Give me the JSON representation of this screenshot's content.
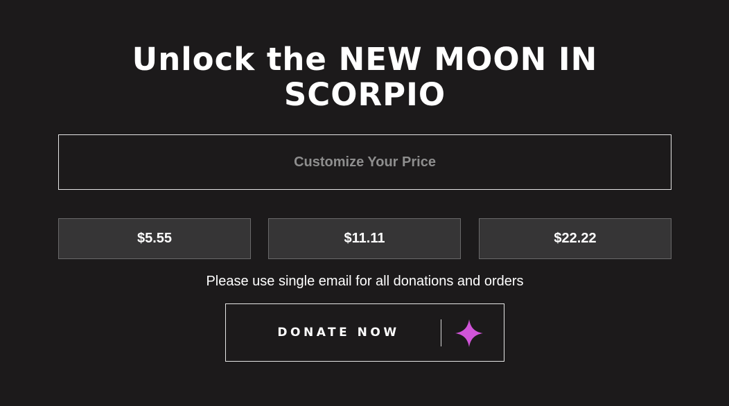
{
  "title": "Unlock the NEW MOON IN SCORPIO",
  "custom_price": {
    "placeholder": "Customize Your Price",
    "value": ""
  },
  "amounts": [
    {
      "label": "$5.55"
    },
    {
      "label": "$11.11"
    },
    {
      "label": "$22.22"
    }
  ],
  "notice": "Please use single email for all donations and orders",
  "donate": {
    "label": "DONATE NOW",
    "icon": "sparkle-icon"
  },
  "colors": {
    "background": "#1c1a1b",
    "button_fill": "#363536",
    "accent": "#d054d8",
    "text": "#ffffff",
    "placeholder": "#8e8e8e"
  }
}
